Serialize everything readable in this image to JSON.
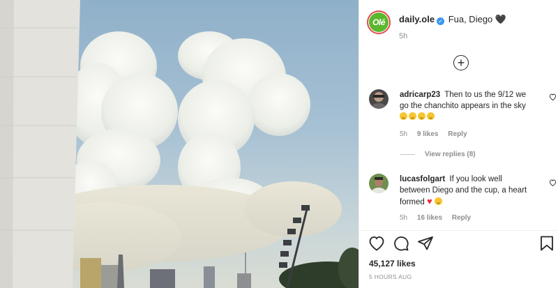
{
  "post": {
    "brand_badge": "Olé",
    "username": "daily.ole",
    "verified": "✓",
    "caption": "Fua, Diego 🖤",
    "time": "5h",
    "load_more": "+"
  },
  "comments": [
    {
      "username": "adricarp23",
      "text": "Then to us the 9/12 we go the chanchito appears in the sky",
      "time": "5h",
      "likes": "9 likes",
      "reply": "Reply",
      "view_replies": "View replies (8)"
    },
    {
      "username": "lucasfolgart",
      "text": "If you look well between Diego and the cup, a heart formed",
      "time": "5h",
      "likes": "16 likes",
      "reply": "Reply"
    }
  ],
  "footer": {
    "likes": "45,127 likes",
    "date": "5 HOURS AUG"
  },
  "colors": {
    "brand_green": "#5bb82e",
    "verified_blue": "#3897f0",
    "heart_red": "#ed2f3f",
    "meta_gray": "#8e8e8e"
  },
  "icons": [
    "like-icon",
    "comment-icon",
    "share-icon",
    "save-icon",
    "comment-like-icon",
    "add-circle-icon",
    "verified-icon"
  ]
}
